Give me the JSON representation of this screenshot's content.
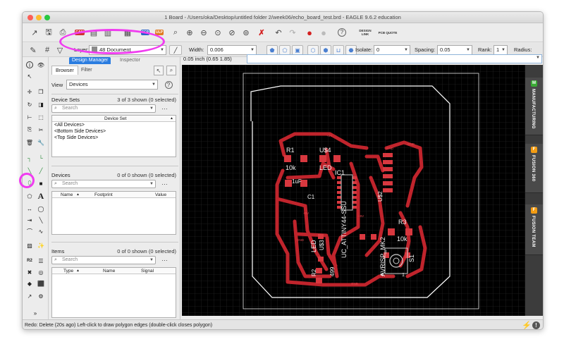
{
  "window": {
    "title": "1 Board - /Users/oka/Desktop/untitled folder 2/week06/echo_board_test.brd - EAGLE 9.6.2 education"
  },
  "toolbar": {
    "scr": "SCR",
    "ulp": "ULP",
    "design_link": "DESIGN LINK",
    "pcb_quote": "PCB QUOTE",
    "help": "?"
  },
  "paramsbar": {
    "layer_label": "Layer:",
    "layer_value": "48 Document",
    "layer_color": "#8a8a8a",
    "width_label": "Width:",
    "width_value": "0.006",
    "isolate_label": "Isolate:",
    "isolate_value": "0",
    "spacing_label": "Spacing:",
    "spacing_value": "0.05",
    "rank_label": "Rank:",
    "rank_value": "1",
    "radius_label": "Radius:"
  },
  "panel": {
    "tab_design_manager": "Design Manager",
    "tab_inspector": "Inspector",
    "subtab_browser": "Browser",
    "subtab_filter": "Filter",
    "view_label": "View",
    "view_value": "Devices",
    "help": "?",
    "device_sets": {
      "title": "Device Sets",
      "count": "3 of 3 shown (0 selected)",
      "search_placeholder": "Search",
      "column": "Device Set",
      "rows": [
        "<All Devices>",
        "<Bottom Side Devices>",
        "<Top Side Devices>"
      ]
    },
    "devices": {
      "title": "Devices",
      "count": "0 of 0 shown (0 selected)",
      "search_placeholder": "Search",
      "columns": [
        "Name",
        "Footprint",
        "Value"
      ]
    },
    "items": {
      "title": "Items",
      "count": "0 of 0 shown (0 selected)",
      "search_placeholder": "Search",
      "columns": [
        "Type",
        "Name",
        "Signal"
      ]
    }
  },
  "coord_readout": "0.05 inch (0.65 1.85)",
  "right_tabs": [
    {
      "label": "MANUFACTURING",
      "color": "#3aaa35",
      "icon": "M"
    },
    {
      "label": "FUSION 360",
      "color": "#f39c12",
      "icon": "F"
    },
    {
      "label": "FUSION TEAM",
      "color": "#f39c12",
      "icon": "F"
    }
  ],
  "board": {
    "labels": [
      "R1",
      "U$4",
      "10k",
      "LED",
      "IC1",
      "1uF",
      "C1",
      "UC_ATTINY44-SSU",
      "U$2",
      "R3",
      "10k",
      "LED",
      "U$3",
      "AVRISP_MK2",
      "S1",
      "R2",
      "499",
      "1",
      "4"
    ],
    "net_labels": [
      "+5V",
      "GND"
    ]
  },
  "status": {
    "text": "Redo: Delete (20s ago) Left-click to draw polygon edges (double-click closes polygon)"
  },
  "colors": {
    "trace": "#c0242c",
    "pad": "#d8383f",
    "canvas": "#000000",
    "outline": "#ffffff",
    "highlight": "#f03cf0"
  }
}
